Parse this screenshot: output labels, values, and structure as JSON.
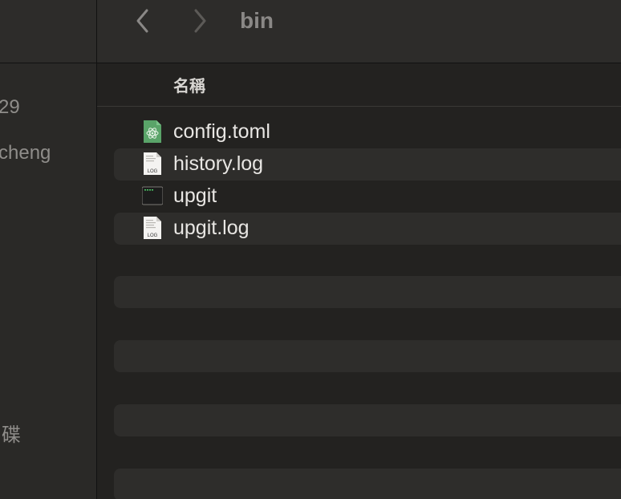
{
  "toolbar": {
    "title": "bin",
    "back_icon": "chevron-left-icon",
    "forward_icon": "chevron-right-icon"
  },
  "sidebar": {
    "items": [
      {
        "label": "29"
      },
      {
        "label": "cheng"
      },
      {
        "label": "碟"
      }
    ]
  },
  "list": {
    "column_name": "名稱",
    "files": [
      {
        "name": "config.toml",
        "icon": "toml-file-icon"
      },
      {
        "name": "history.log",
        "icon": "log-file-icon",
        "badge": "LOG"
      },
      {
        "name": "upgit",
        "icon": "terminal-executable-icon"
      },
      {
        "name": "upgit.log",
        "icon": "log-file-icon",
        "badge": "LOG"
      }
    ]
  },
  "colors": {
    "background": "#232220",
    "alt_row": "#2e2d2b",
    "text": "#e8e6e3",
    "muted": "#8f8d8a",
    "toml_green": "#5aa469"
  }
}
